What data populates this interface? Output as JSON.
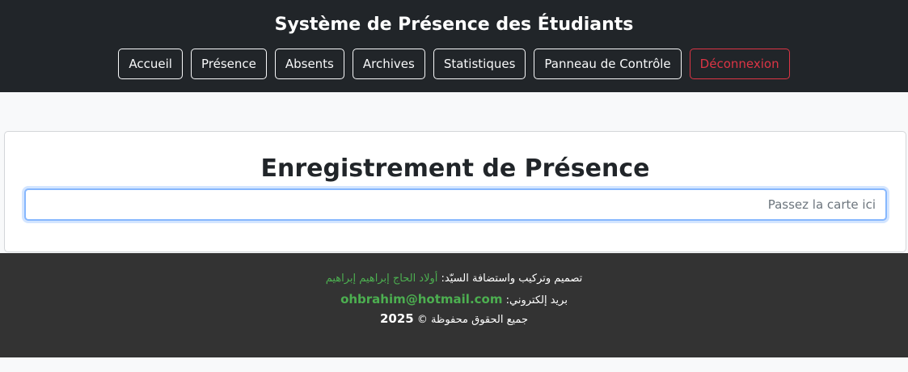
{
  "header": {
    "title": "Système de Présence des Étudiants",
    "nav": [
      {
        "label": "Accueil"
      },
      {
        "label": "Présence"
      },
      {
        "label": "Absents"
      },
      {
        "label": "Archives"
      },
      {
        "label": "Statistiques"
      },
      {
        "label": "Panneau de Contrôle"
      },
      {
        "label": "Déconnexion"
      }
    ]
  },
  "main": {
    "heading": "Enregistrement de Présence",
    "input": {
      "value": "",
      "placeholder": "Passez la carte ici"
    }
  },
  "footer": {
    "design_label": "تصميم وتركيب واستضافة السيّد:",
    "design_name": "أولاد الحاج إبراهيم إبراهيم",
    "email_label": "بريد إلكتروني:",
    "email": "ohbrahim@hotmail.com",
    "rights_label": "جميع الحقوق محفوظة ©",
    "year": "2025"
  },
  "colors": {
    "header_bg": "#212529",
    "footer_bg": "#333333",
    "danger": "#dc3545",
    "accent_green": "#4caf50",
    "focus_border": "#86b7fe"
  }
}
